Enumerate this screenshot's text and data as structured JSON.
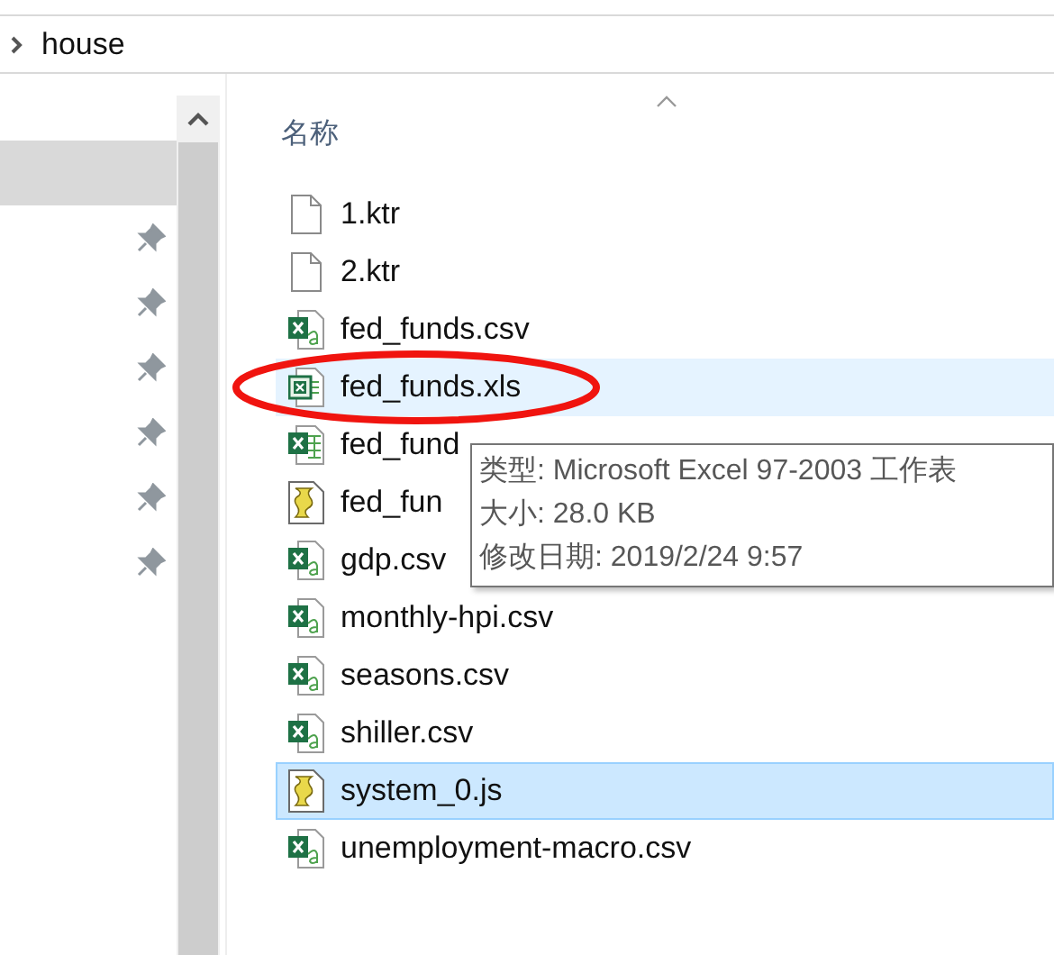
{
  "address_bar": {
    "path": "house"
  },
  "navigation_pane": {
    "items": [
      {
        "selected": true,
        "pinned": false
      },
      {
        "selected": false,
        "pinned": true
      },
      {
        "selected": false,
        "pinned": true
      },
      {
        "selected": false,
        "pinned": true
      },
      {
        "selected": false,
        "pinned": true
      },
      {
        "selected": false,
        "pinned": true
      },
      {
        "selected": false,
        "pinned": true
      }
    ]
  },
  "file_list": {
    "column_header": "名称",
    "sort_ascending": true,
    "files": [
      {
        "name": "1.ktr",
        "kind": "text",
        "selected": false,
        "hovered": false
      },
      {
        "name": "2.ktr",
        "kind": "text",
        "selected": false,
        "hovered": false
      },
      {
        "name": "fed_funds.csv",
        "kind": "csv",
        "selected": false,
        "hovered": false
      },
      {
        "name": "fed_funds.xls",
        "kind": "xls",
        "selected": false,
        "hovered": true
      },
      {
        "name": "fed_fund",
        "kind": "xlsx",
        "selected": false,
        "hovered": false
      },
      {
        "name": "fed_fun",
        "kind": "script",
        "selected": false,
        "hovered": false
      },
      {
        "name": "gdp.csv",
        "kind": "csv",
        "selected": false,
        "hovered": false
      },
      {
        "name": "monthly-hpi.csv",
        "kind": "csv",
        "selected": false,
        "hovered": false
      },
      {
        "name": "seasons.csv",
        "kind": "csv",
        "selected": false,
        "hovered": false
      },
      {
        "name": "shiller.csv",
        "kind": "csv",
        "selected": false,
        "hovered": false
      },
      {
        "name": "system_0.js",
        "kind": "script",
        "selected": true,
        "hovered": false
      },
      {
        "name": "unemployment-macro.csv",
        "kind": "csv",
        "selected": false,
        "hovered": false
      }
    ]
  },
  "tooltip": {
    "lines": [
      "类型: Microsoft Excel 97-2003 工作表",
      "大小: 28.0 KB",
      "修改日期: 2019/2/24 9:57"
    ]
  },
  "annotation": {
    "kind": "ellipse"
  }
}
